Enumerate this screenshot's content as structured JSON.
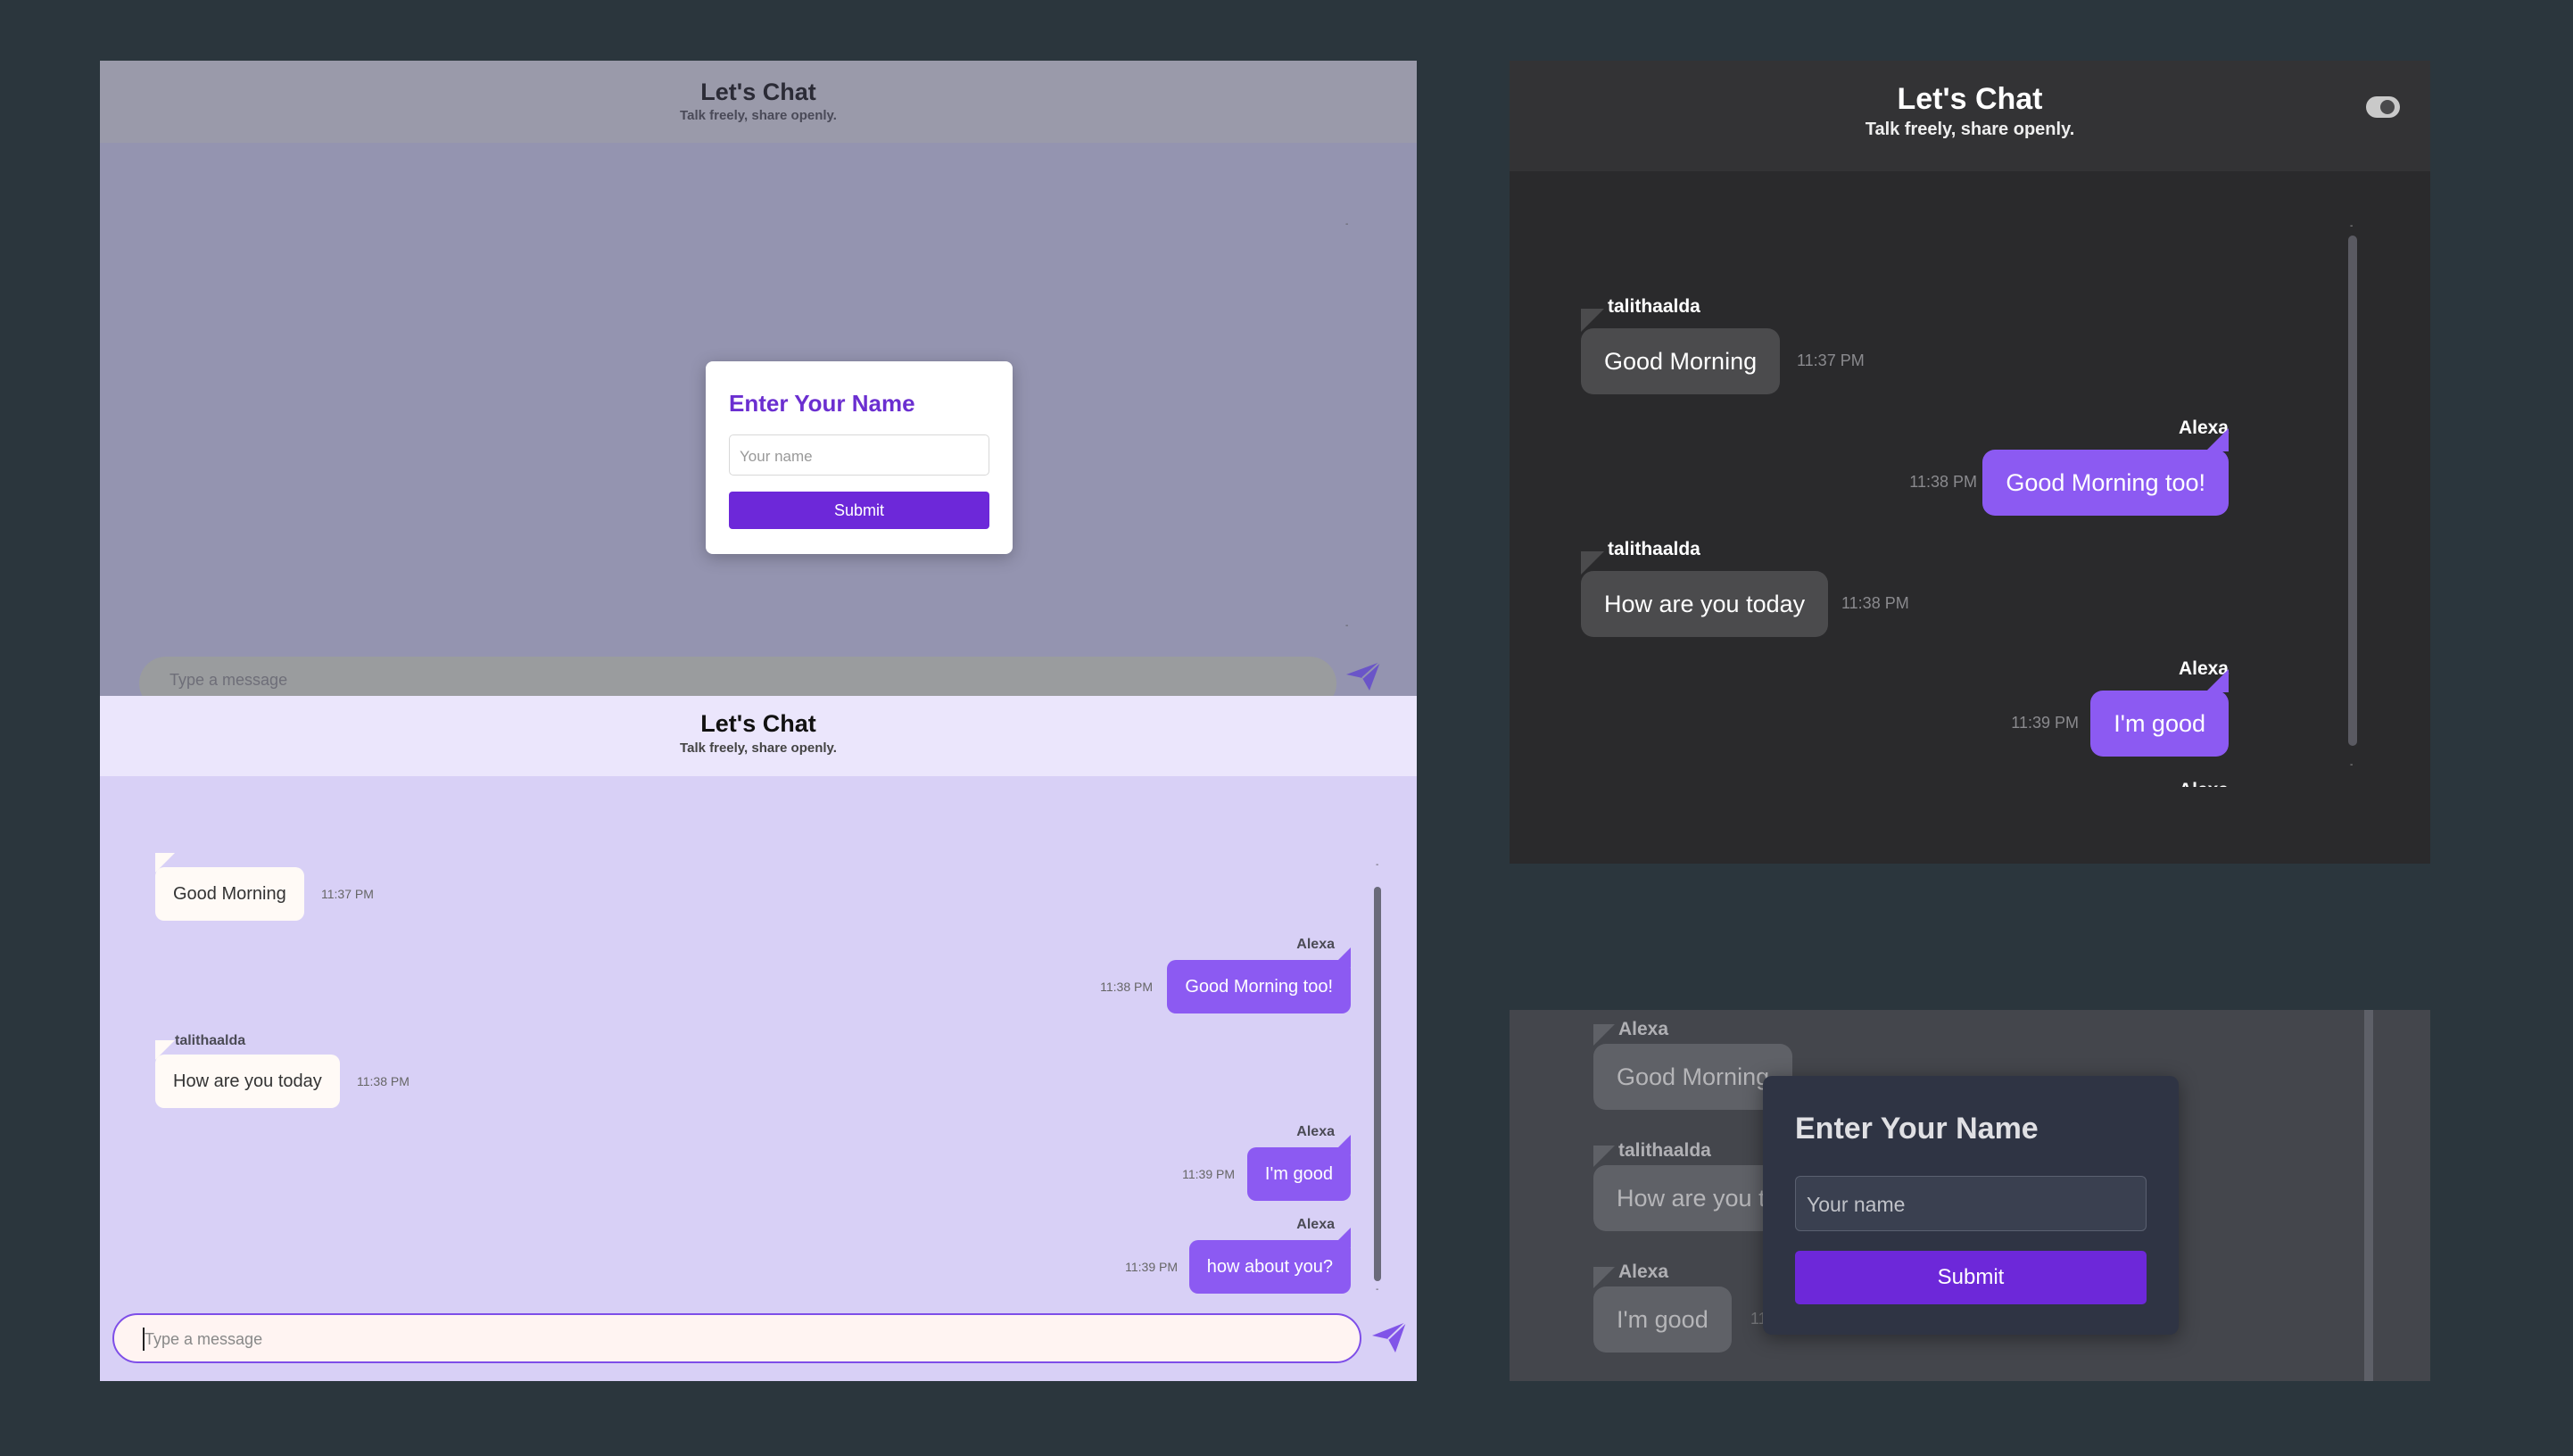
{
  "app": {
    "title": "Let's Chat",
    "subtitle": "Talk freely, share openly."
  },
  "name_modal": {
    "heading": "Enter Your Name",
    "placeholder": "Your name",
    "submit_label": "Submit"
  },
  "composer": {
    "placeholder": "Type a message"
  },
  "messages": [
    {
      "sender": "talithaalda",
      "text": "Good Morning",
      "time": "11:37 PM",
      "direction": "incoming"
    },
    {
      "sender": "Alexa",
      "text": "Good Morning too!",
      "time": "11:38 PM",
      "direction": "outgoing"
    },
    {
      "sender": "talithaalda",
      "text": "How are you today",
      "time": "11:38 PM",
      "direction": "incoming"
    },
    {
      "sender": "Alexa",
      "text": "I'm good",
      "time": "11:39 PM",
      "direction": "outgoing"
    },
    {
      "sender": "Alexa",
      "text": "how about you?",
      "time": "11:39 PM",
      "direction": "outgoing"
    }
  ],
  "peer_view_messages": [
    {
      "sender": "Alexa",
      "text": "Good Morning",
      "direction": "incoming"
    },
    {
      "sender": "talithaalda",
      "text": "How are you today",
      "direction": "incoming"
    },
    {
      "sender": "Alexa",
      "text": "I'm good",
      "time": "11",
      "direction": "incoming"
    }
  ],
  "theme_toggle": {
    "mode": "dark"
  },
  "colors": {
    "accent": "#6d28d9",
    "outgoing_bubble": "#8c5af2",
    "light_background": "#d8d0f6",
    "dark_background": "#2a2a2c",
    "page_background": "#2b363d"
  },
  "icons": {
    "send": "send-icon",
    "toggle": "theme-toggle-icon"
  }
}
